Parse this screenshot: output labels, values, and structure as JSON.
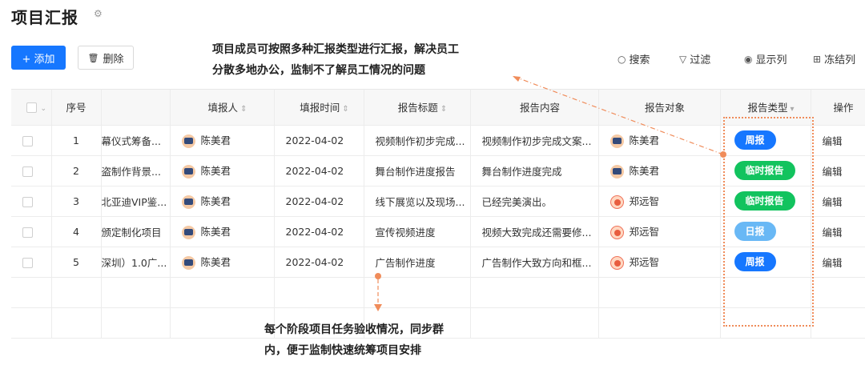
{
  "page": {
    "title": "项目汇报",
    "settings_icon": "gear-icon"
  },
  "toolbar": {
    "add_label": "+ 添加",
    "delete_label": "删除",
    "search_label": "搜索",
    "filter_label": "过滤",
    "display_label": "显示列",
    "freeze_label": "冻结列"
  },
  "annotations": {
    "top_line1": "项目成员可按照多种汇报类型进行汇报，解决员工",
    "top_line2": "分散多地办公，监制不了解员工情况的问题",
    "bottom_line1": "每个阶段项目任务验收情况，同步群",
    "bottom_line2": "内，便于监制快速统筹项目安排"
  },
  "table": {
    "headers": {
      "index": "序号",
      "reporter": "填报人",
      "time": "填报时间",
      "title": "报告标题",
      "content": "报告内容",
      "target": "报告对象",
      "type": "报告类型",
      "action": "操作"
    },
    "rows": [
      {
        "index": "1",
        "project": "幕仪式筹备...",
        "reporter": "陈美君",
        "time": "2022-04-02",
        "title": "视频制作初步完成...",
        "content": "视频制作初步完成文案...",
        "target": "陈美君",
        "type": "周报",
        "action": "编辑"
      },
      {
        "index": "2",
        "project": "盗制作背景...",
        "reporter": "陈美君",
        "time": "2022-04-02",
        "title": "舞台制作进度报告",
        "content": "舞台制作进度完成",
        "target": "陈美君",
        "type": "临时报告",
        "action": "编辑"
      },
      {
        "index": "3",
        "project": "北亚迪VIP鉴...",
        "reporter": "陈美君",
        "time": "2022-04-02",
        "title": "线下展览以及现场...",
        "content": "已经完美演出。",
        "target": "郑远智",
        "type": "临时报告",
        "action": "编辑"
      },
      {
        "index": "4",
        "project": "颁定制化项目",
        "reporter": "陈美君",
        "time": "2022-04-02",
        "title": "宣传视频进度",
        "content": "视频大致完成还需要修...",
        "target": "郑远智",
        "type": "日报",
        "action": "编辑"
      },
      {
        "index": "5",
        "project": "深圳）1.0广...",
        "reporter": "陈美君",
        "time": "2022-04-02",
        "title": "广告制作进度",
        "content": "广告制作大致方向和框...",
        "target": "郑远智",
        "type": "周报",
        "action": "编辑"
      }
    ]
  },
  "colors": {
    "primary": "#1677ff",
    "badge_weekly": "#1677ff",
    "badge_temp": "#12c35e",
    "badge_daily": "#69b8f5",
    "annotation_line": "#f08c5a"
  }
}
